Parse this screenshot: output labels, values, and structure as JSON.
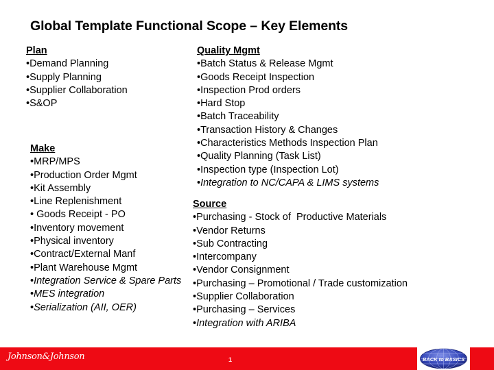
{
  "title": "Global Template Functional Scope – Key Elements",
  "sections": {
    "plan": {
      "heading": "Plan",
      "items": [
        {
          "text": "Demand Planning"
        },
        {
          "text": "Supply Planning"
        },
        {
          "text": "Supplier Collaboration"
        },
        {
          "text": "S&OP"
        }
      ]
    },
    "quality": {
      "heading": "Quality Mgmt",
      "items": [
        {
          "text": "Batch Status & Release Mgmt"
        },
        {
          "text": "Goods Receipt Inspection"
        },
        {
          "text": "Inspection Prod orders"
        },
        {
          "text": "Hard Stop"
        },
        {
          "text": "Batch Traceability"
        },
        {
          "text": "Transaction History & Changes"
        },
        {
          "text": "Characteristics Methods Inspection Plan"
        },
        {
          "text": "Quality Planning (Task List)"
        },
        {
          "text": "Inspection type (Inspection Lot)"
        },
        {
          "text": "Integration to NC/CAPA & LIMS systems"
        }
      ]
    },
    "make": {
      "heading": "Make",
      "items": [
        {
          "text": "MRP/MPS"
        },
        {
          "text": "Production Order Mgmt"
        },
        {
          "text": "Kit Assembly"
        },
        {
          "text": "Line Replenishment"
        },
        {
          "text": " Goods Receipt - PO"
        },
        {
          "text": "Inventory movement"
        },
        {
          "text": "Physical inventory"
        },
        {
          "text": "Contract/External Manf"
        },
        {
          "text": "Plant Warehouse Mgmt"
        },
        {
          "text": "Integration Service & Spare Parts"
        },
        {
          "text": "MES integration"
        },
        {
          "text": "Serialization (AII, OER)"
        }
      ]
    },
    "source": {
      "heading": "Source",
      "items": [
        {
          "text": "Purchasing - Stock of  Productive Materials"
        },
        {
          "text": "Vendor Returns"
        },
        {
          "text": "Sub Contracting"
        },
        {
          "text": "Intercompany"
        },
        {
          "text": "Vendor Consignment"
        },
        {
          "text": "Purchasing – Promotional / Trade customization"
        },
        {
          "text": "Supplier Collaboration"
        },
        {
          "text": "Purchasing – Services"
        },
        {
          "text": "Integration with ARIBA"
        }
      ]
    }
  },
  "bullet": "•",
  "footer": {
    "company_logo": "Johnson&Johnson",
    "page_number": "1",
    "badge_logo": "BACK to BASICS",
    "color": "#ee0a14"
  }
}
